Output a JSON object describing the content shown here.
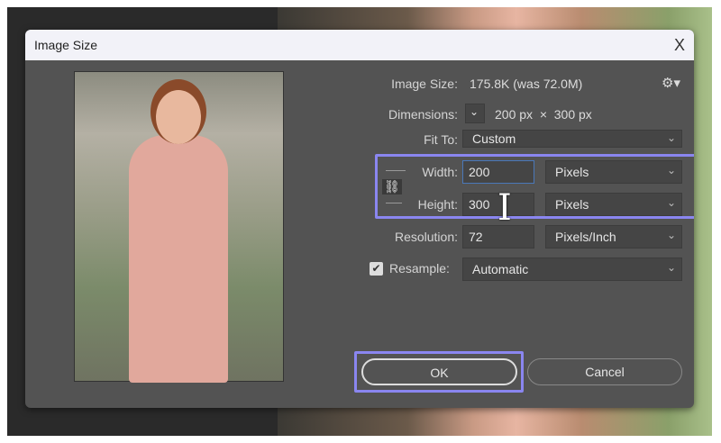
{
  "dialog": {
    "title": "Image Size",
    "close": "X"
  },
  "info": {
    "image_size_label": "Image Size:",
    "image_size_value": "175.8K (was 72.0M)",
    "dimensions_label": "Dimensions:",
    "dimensions_value": "200 px  ×  300 px"
  },
  "fit_to": {
    "label": "Fit To:",
    "value": "Custom"
  },
  "width": {
    "label": "Width:",
    "value": "200",
    "unit": "Pixels"
  },
  "height": {
    "label": "Height:",
    "value": "300",
    "unit": "Pixels"
  },
  "resolution": {
    "label": "Resolution:",
    "value": "72",
    "unit": "Pixels/Inch"
  },
  "resample": {
    "label": "Resample:",
    "value": "Automatic",
    "checked": true
  },
  "buttons": {
    "ok": "OK",
    "cancel": "Cancel"
  },
  "highlight_color": "#8a86f0"
}
